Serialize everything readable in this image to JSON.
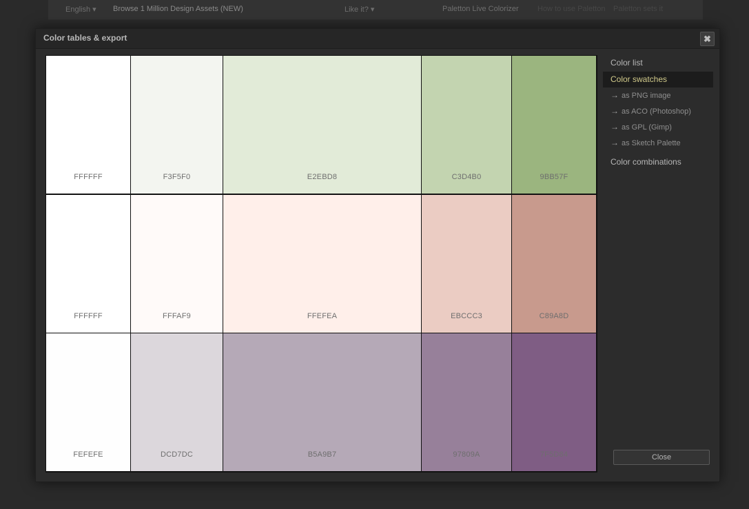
{
  "topbar": {
    "language": "English ▾",
    "browse": "Browse 1 Million Design Assets (NEW)",
    "like": "Like it? ▾",
    "colorizer": "Paletton Live Colorizer",
    "faint_left": "How to use Paletton",
    "faint_right": "Paletton sets it"
  },
  "modal": {
    "title": "Color tables & export",
    "close_icon": "close-x-icon"
  },
  "swatches": {
    "rows": [
      {
        "cells": [
          {
            "hex": "FFFFFF",
            "color": "#FFFFFF"
          },
          {
            "hex": "F3F5F0",
            "color": "#F3F5F0"
          },
          {
            "hex": "E2EBD8",
            "color": "#E2EBD8"
          },
          {
            "hex": "C3D4B0",
            "color": "#C3D4B0"
          },
          {
            "hex": "9BB57F",
            "color": "#9BB57F"
          }
        ]
      },
      {
        "cells": [
          {
            "hex": "FFFFFF",
            "color": "#FFFFFF"
          },
          {
            "hex": "FFFAF9",
            "color": "#FFFAF9"
          },
          {
            "hex": "FFEFEA",
            "color": "#FFEFEA"
          },
          {
            "hex": "EBCCC3",
            "color": "#EBCCC3"
          },
          {
            "hex": "C89A8D",
            "color": "#C89A8D"
          }
        ]
      },
      {
        "cells": [
          {
            "hex": "FEFEFE",
            "color": "#FEFEFE"
          },
          {
            "hex": "DCD7DC",
            "color": "#DCD7DC"
          },
          {
            "hex": "B5A9B7",
            "color": "#B5A9B7"
          },
          {
            "hex": "97809A",
            "color": "#97809A"
          },
          {
            "hex": "7F5D84",
            "color": "#7F5D84"
          }
        ]
      }
    ]
  },
  "sidebar": {
    "color_list": "Color list",
    "color_swatches": "Color swatches",
    "exports": [
      {
        "label": "as PNG image"
      },
      {
        "label": "as ACO (Photoshop)"
      },
      {
        "label": "as GPL (Gimp)"
      },
      {
        "label": "as Sketch Palette"
      }
    ],
    "arrow": "→",
    "color_combinations": "Color combinations"
  },
  "footer": {
    "close_label": "Close"
  },
  "colors": {
    "active_menu_text": "#d0c98a",
    "modal_bg": "#2c2c2c"
  }
}
